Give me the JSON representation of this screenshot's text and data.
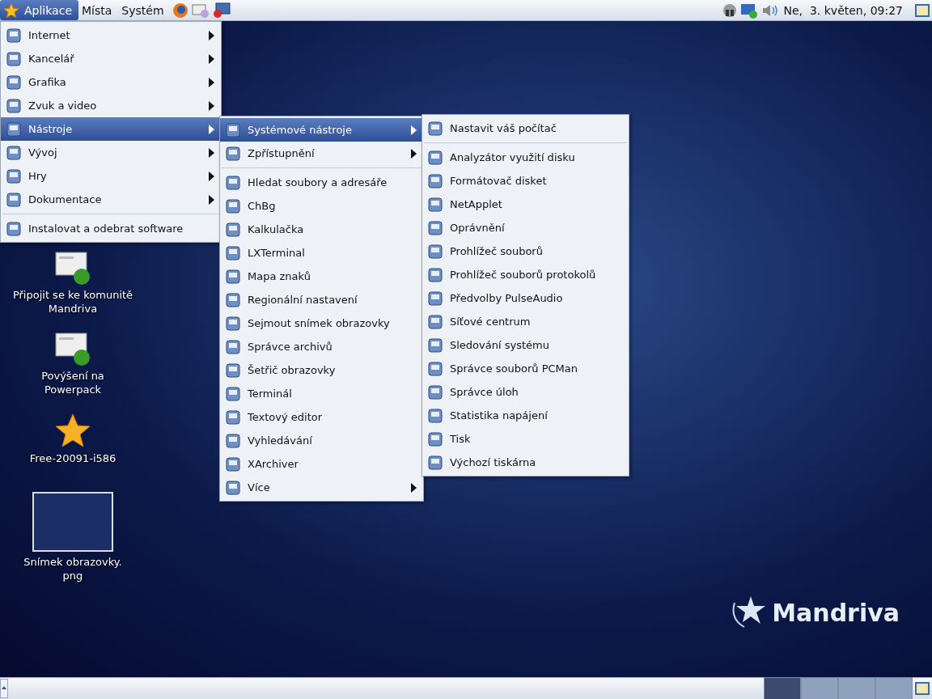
{
  "top_panel": {
    "menus": [
      {
        "label": "Aplikace",
        "selected": true
      },
      {
        "label": "Místa",
        "selected": false
      },
      {
        "label": "Systém",
        "selected": false
      }
    ],
    "clock": "Ne,  3. květen, 09:27"
  },
  "applications_menu": [
    {
      "kind": "submenu",
      "label": "Internet",
      "selected": false
    },
    {
      "kind": "submenu",
      "label": "Kancelář",
      "selected": false
    },
    {
      "kind": "submenu",
      "label": "Grafika",
      "selected": false
    },
    {
      "kind": "submenu",
      "label": "Zvuk a video",
      "selected": false
    },
    {
      "kind": "submenu",
      "label": "Nástroje",
      "selected": true
    },
    {
      "kind": "submenu",
      "label": "Vývoj",
      "selected": false
    },
    {
      "kind": "submenu",
      "label": "Hry",
      "selected": false
    },
    {
      "kind": "submenu",
      "label": "Dokumentace",
      "selected": false
    },
    {
      "kind": "separator"
    },
    {
      "kind": "item",
      "label": "Instalovat a odebrat software",
      "selected": false
    }
  ],
  "tools_menu": [
    {
      "kind": "submenu",
      "label": "Systémové nástroje",
      "selected": true
    },
    {
      "kind": "submenu",
      "label": "Zpřístupnění",
      "selected": false
    },
    {
      "kind": "separator"
    },
    {
      "kind": "item",
      "label": "Hledat soubory a adresáře",
      "selected": false
    },
    {
      "kind": "item",
      "label": "ChBg",
      "selected": false
    },
    {
      "kind": "item",
      "label": "Kalkulačka",
      "selected": false
    },
    {
      "kind": "item",
      "label": "LXTerminal",
      "selected": false
    },
    {
      "kind": "item",
      "label": "Mapa znaků",
      "selected": false
    },
    {
      "kind": "item",
      "label": "Regionální nastavení",
      "selected": false
    },
    {
      "kind": "item",
      "label": "Sejmout snímek obrazovky",
      "selected": false
    },
    {
      "kind": "item",
      "label": "Správce archivů",
      "selected": false
    },
    {
      "kind": "item",
      "label": "Šetřič obrazovky",
      "selected": false
    },
    {
      "kind": "item",
      "label": "Terminál",
      "selected": false
    },
    {
      "kind": "item",
      "label": "Textový editor",
      "selected": false
    },
    {
      "kind": "item",
      "label": "Vyhledávání",
      "selected": false
    },
    {
      "kind": "item",
      "label": "XArchiver",
      "selected": false
    },
    {
      "kind": "submenu",
      "label": "Více",
      "selected": false
    }
  ],
  "system_tools_menu": [
    {
      "kind": "item",
      "label": "Nastavit váš počítač",
      "selected": false
    },
    {
      "kind": "separator"
    },
    {
      "kind": "item",
      "label": "Analyzátor využití disku",
      "selected": false
    },
    {
      "kind": "item",
      "label": "Formátovač disket",
      "selected": false
    },
    {
      "kind": "item",
      "label": "NetApplet",
      "selected": false
    },
    {
      "kind": "item",
      "label": "Oprávnění",
      "selected": false
    },
    {
      "kind": "item",
      "label": "Prohlížeč souborů",
      "selected": false
    },
    {
      "kind": "item",
      "label": "Prohlížeč souborů protokolů",
      "selected": false
    },
    {
      "kind": "item",
      "label": "Předvolby PulseAudio",
      "selected": false
    },
    {
      "kind": "item",
      "label": "Síťové centrum",
      "selected": false
    },
    {
      "kind": "item",
      "label": "Sledování systému",
      "selected": false
    },
    {
      "kind": "item",
      "label": "Správce souborů PCMan",
      "selected": false
    },
    {
      "kind": "item",
      "label": "Správce úloh",
      "selected": false
    },
    {
      "kind": "item",
      "label": "Statistika napájení",
      "selected": false
    },
    {
      "kind": "item",
      "label": "Tisk",
      "selected": false
    },
    {
      "kind": "item",
      "label": "Výchozí tiskárna",
      "selected": false
    }
  ],
  "desktop_icons": [
    {
      "kind": "launcher-join",
      "label": "Připojit se ke komunitě Mandriva"
    },
    {
      "kind": "launcher-upgrade",
      "label": "Povýšení na Powerpack"
    },
    {
      "kind": "star",
      "label": "Free-20091-i586"
    },
    {
      "kind": "image",
      "label": "Snímek obrazovky.\npng"
    }
  ],
  "wallpaper_logo": "Mandriva",
  "bottom_panel": {
    "workspaces": [
      {
        "selected": true
      },
      {
        "selected": false
      },
      {
        "selected": false
      },
      {
        "selected": false
      }
    ]
  }
}
